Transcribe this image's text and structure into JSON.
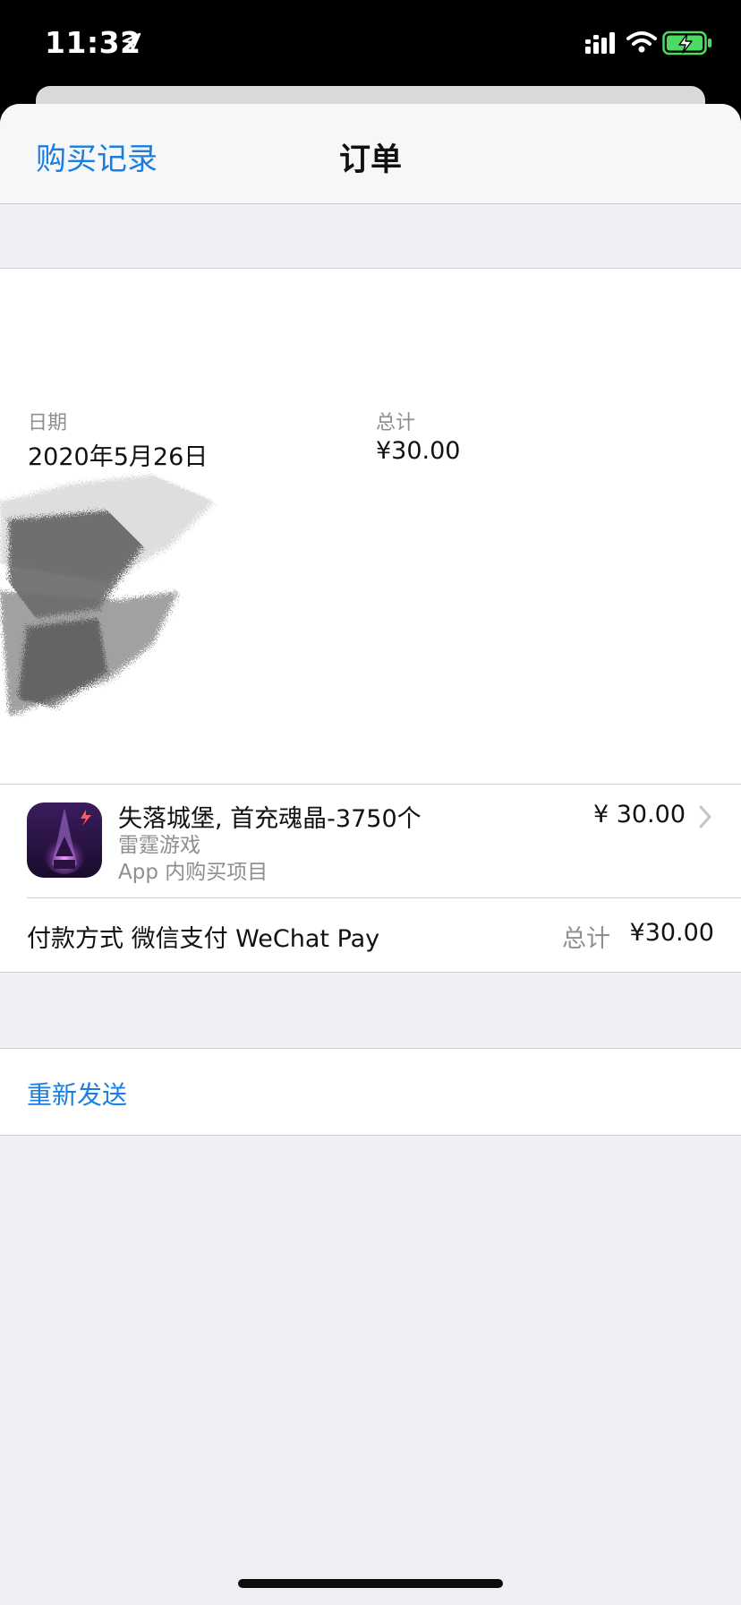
{
  "status_bar": {
    "time": "11:32",
    "icons": [
      "location-arrow-icon",
      "signal-icon",
      "wifi-icon",
      "battery-charging-icon"
    ],
    "battery_color": "#4cd964"
  },
  "nav": {
    "back_label": "购买记录",
    "title": "订单"
  },
  "order": {
    "date_label": "日期",
    "date_value": "2020年5月26日",
    "total_label": "总计",
    "total_value": "¥30.00"
  },
  "item": {
    "name": "失落城堡, 首充魂晶-3750个",
    "developer": "雷霆游戏",
    "type": "App 内购买项目",
    "price": "¥ 30.00",
    "icon": "lost-castle-app-icon"
  },
  "payment": {
    "method_label": "付款方式 微信支付 WeChat Pay",
    "total_label": "总计",
    "total_value": "¥30.00"
  },
  "actions": {
    "resend_label": "重新发送"
  },
  "colors": {
    "accent": "#1a7ee0",
    "secondary_text": "#8e8e93",
    "background": "#f0f0f4"
  }
}
